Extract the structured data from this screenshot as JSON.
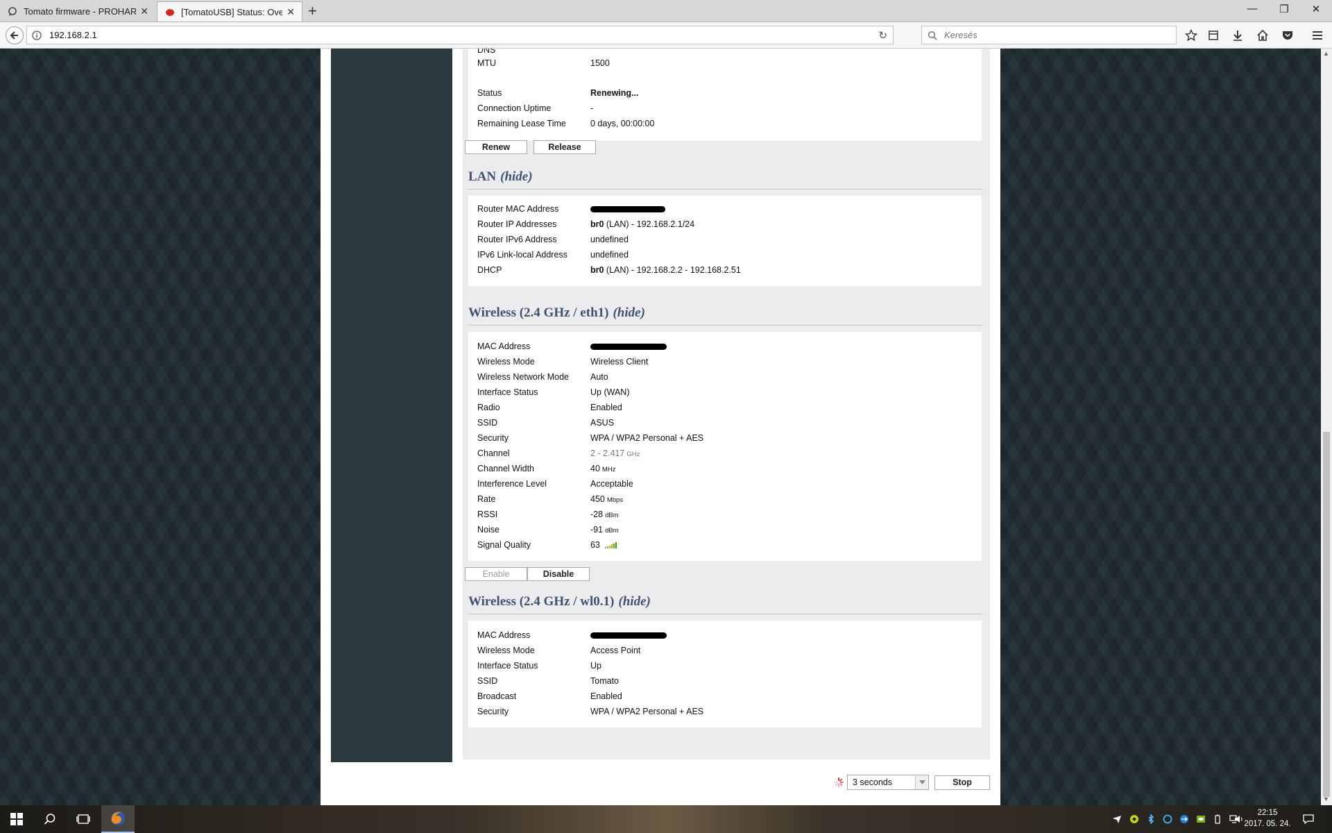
{
  "browser": {
    "tabs": [
      {
        "title": "Tomato firmware - PROHARD",
        "active": false
      },
      {
        "title": "[TomatoUSB] Status: Overview",
        "active": true
      }
    ],
    "url": "192.168.2.1",
    "search_placeholder": "Keresés"
  },
  "wan_tail": {
    "rows": [
      {
        "label": "DNS",
        "value": ""
      },
      {
        "label": "MTU",
        "value": "1500"
      },
      {
        "label": "Status",
        "value": "Renewing..."
      },
      {
        "label": "Connection Uptime",
        "value": "-"
      },
      {
        "label": "Remaining Lease Time",
        "value": "0 days, 00:00:00"
      }
    ],
    "buttons": {
      "renew": "Renew",
      "release": "Release"
    }
  },
  "lan": {
    "title": "LAN",
    "hide": "(hide)",
    "rows": [
      {
        "label": "Router MAC Address",
        "value": ""
      },
      {
        "label": "Router IP Addresses",
        "iface": "br0",
        "value": " (LAN) - 192.168.2.1/24"
      },
      {
        "label": "Router IPv6 Address",
        "value": "undefined"
      },
      {
        "label": "IPv6 Link-local Address",
        "value": "undefined"
      },
      {
        "label": "DHCP",
        "iface": "br0",
        "value": " (LAN) - 192.168.2.2 - 192.168.2.51"
      }
    ]
  },
  "wireless_eth1": {
    "title": "Wireless (2.4 GHz / eth1)",
    "hide": "(hide)",
    "rows": [
      {
        "label": "MAC Address",
        "value": ""
      },
      {
        "label": "Wireless Mode",
        "value": "Wireless Client"
      },
      {
        "label": "Wireless Network Mode",
        "value": "Auto"
      },
      {
        "label": "Interface Status",
        "value": "Up (WAN)"
      },
      {
        "label": "Radio",
        "value": "Enabled"
      },
      {
        "label": "SSID",
        "value": "ASUS"
      },
      {
        "label": "Security",
        "value": "WPA / WPA2 Personal + AES"
      },
      {
        "label": "Channel",
        "value": "2 - 2.417",
        "unit": "GHz"
      },
      {
        "label": "Channel Width",
        "value": "40",
        "unit": "MHz"
      },
      {
        "label": "Interference Level",
        "value": "Acceptable"
      },
      {
        "label": "Rate",
        "value": "450",
        "unit": "Mbps"
      },
      {
        "label": "RSSI",
        "value": "-28",
        "unit": "dBm"
      },
      {
        "label": "Noise",
        "value": "-91",
        "unit": "dBm"
      },
      {
        "label": "Signal Quality",
        "value": "63"
      }
    ],
    "buttons": {
      "enable": "Enable",
      "disable": "Disable"
    }
  },
  "wireless_wl01": {
    "title": "Wireless (2.4 GHz / wl0.1)",
    "hide": "(hide)",
    "rows": [
      {
        "label": "MAC Address",
        "value": ""
      },
      {
        "label": "Wireless Mode",
        "value": "Access Point"
      },
      {
        "label": "Interface Status",
        "value": "Up"
      },
      {
        "label": "SSID",
        "value": "Tomato"
      },
      {
        "label": "Broadcast",
        "value": "Enabled"
      },
      {
        "label": "Security",
        "value": "WPA / WPA2 Personal + AES"
      }
    ]
  },
  "refresh": {
    "interval": "3 seconds",
    "stop": "Stop"
  },
  "taskbar": {
    "time": "22:15",
    "date": "2017. 05. 24."
  },
  "colors": {
    "section_title": "#3e5275",
    "sidebar": "#2a3a3f",
    "content_bg": "#ececec"
  }
}
